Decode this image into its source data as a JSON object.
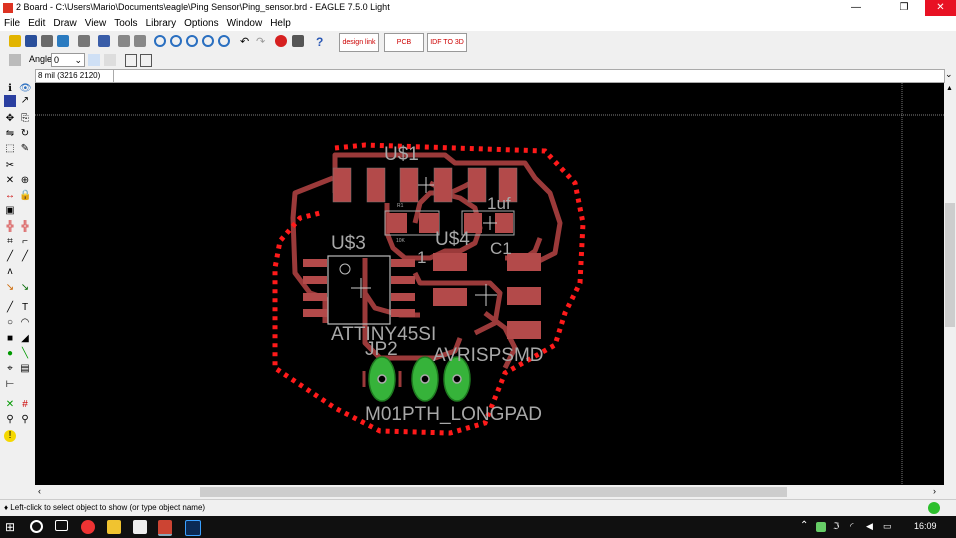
{
  "window": {
    "title": "2 Board - C:\\Users\\Mario\\Documents\\eagle\\Ping Sensor\\Ping_sensor.brd - EAGLE 7.5.0 Light",
    "minimize": "—",
    "maximize": "❐",
    "close": "✕"
  },
  "menu": [
    "File",
    "Edit",
    "Draw",
    "View",
    "Tools",
    "Library",
    "Options",
    "Window",
    "Help"
  ],
  "toolbar": {
    "design_link": "design link",
    "pcb_quote": "PCB QUOTE",
    "pdf_3d": "IDF TO 3D"
  },
  "params": {
    "angle_label": "Angle:",
    "angle_value": "0"
  },
  "command": {
    "coord": "8 mil (3216 2120)",
    "value": ""
  },
  "board": {
    "labels": {
      "u1": "U$1",
      "u3": "U$3",
      "u4": "U$4",
      "c1": "C1",
      "c1_value": "1uf",
      "one": "1",
      "attiny": "ATTINY45SI",
      "jp2": "JP2",
      "avr": "AVRISPSMD",
      "m01": "M01PTH_LONGPAD",
      "r1": "R1",
      "r_val": "10K"
    }
  },
  "colors": {
    "canvas": "#000000",
    "pad": "#b34a4a",
    "route": "#9b3a3a",
    "outline": "#ff1a1a",
    "text": "#a8a8a8",
    "via": "#36b33a"
  },
  "status": {
    "message": "♦ Left-click to select object to show (or type object name)"
  },
  "taskbar": {
    "time": "16:09"
  }
}
